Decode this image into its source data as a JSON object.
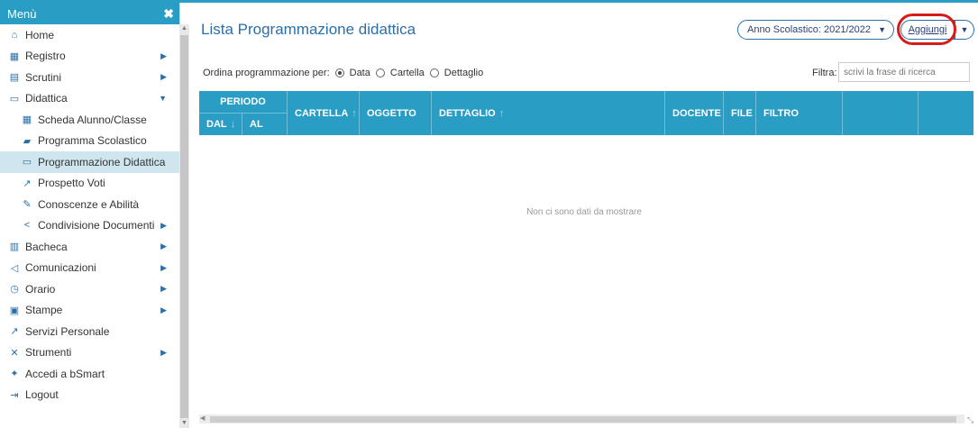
{
  "sidebar": {
    "title": "Menù",
    "items": [
      {
        "label": "Home",
        "icon": "home-icon",
        "glyph": "⌂"
      },
      {
        "label": "Registro",
        "icon": "calendar-icon",
        "glyph": "▦"
      },
      {
        "label": "Scrutini",
        "icon": "document-icon",
        "glyph": "▤"
      },
      {
        "label": "Didattica",
        "icon": "book-icon",
        "glyph": "▭"
      },
      {
        "label": "Scheda Alunno/Classe",
        "icon": "table-icon",
        "glyph": "▦"
      },
      {
        "label": "Programma Scolastico",
        "icon": "book-icon",
        "glyph": "▰"
      },
      {
        "label": "Programmazione Didattica",
        "icon": "keyboard-icon",
        "glyph": "▭"
      },
      {
        "label": "Prospetto Voti",
        "icon": "chart-line-icon",
        "glyph": "↗"
      },
      {
        "label": "Conoscenze e Abilità",
        "icon": "magic-wand-icon",
        "glyph": "✎"
      },
      {
        "label": "Condivisione Documenti",
        "icon": "share-icon",
        "glyph": "<"
      },
      {
        "label": "Bacheca",
        "icon": "board-icon",
        "glyph": "▥"
      },
      {
        "label": "Comunicazioni",
        "icon": "megaphone-icon",
        "glyph": "◁"
      },
      {
        "label": "Orario",
        "icon": "clock-icon",
        "glyph": "◷"
      },
      {
        "label": "Stampe",
        "icon": "printer-icon",
        "glyph": "▣"
      },
      {
        "label": "Servizi Personale",
        "icon": "external-link-icon",
        "glyph": "↗"
      },
      {
        "label": "Strumenti",
        "icon": "tools-icon",
        "glyph": "✕"
      },
      {
        "label": "Accedi a bSmart",
        "icon": "tree-icon",
        "glyph": "✦"
      },
      {
        "label": "Logout",
        "icon": "logout-icon",
        "glyph": "⇥"
      }
    ]
  },
  "header": {
    "title": "Lista Programmazione didattica",
    "year_select": "Anno Scolastico: 2021/2022",
    "add_button": "Aggiungi"
  },
  "order": {
    "label": "Ordina programmazione per:",
    "options": [
      "Data",
      "Cartella",
      "Dettaglio"
    ],
    "selected": "Data"
  },
  "filter": {
    "label": "Filtra:",
    "placeholder": "scrivi la frase di ricerca"
  },
  "table": {
    "columns": {
      "periodo": "PERIODO",
      "dal": "DAL",
      "al": "AL",
      "cartella": "CARTELLA",
      "oggetto": "OGGETTO",
      "dettaglio": "DETTAGLIO",
      "docente": "DOCENTE",
      "file": "FILE",
      "filtro": "FILTRO"
    },
    "empty_message": "Non ci sono dati da mostrare"
  },
  "colors": {
    "accent": "#2a9dc4",
    "highlight": "#d81a1a"
  }
}
